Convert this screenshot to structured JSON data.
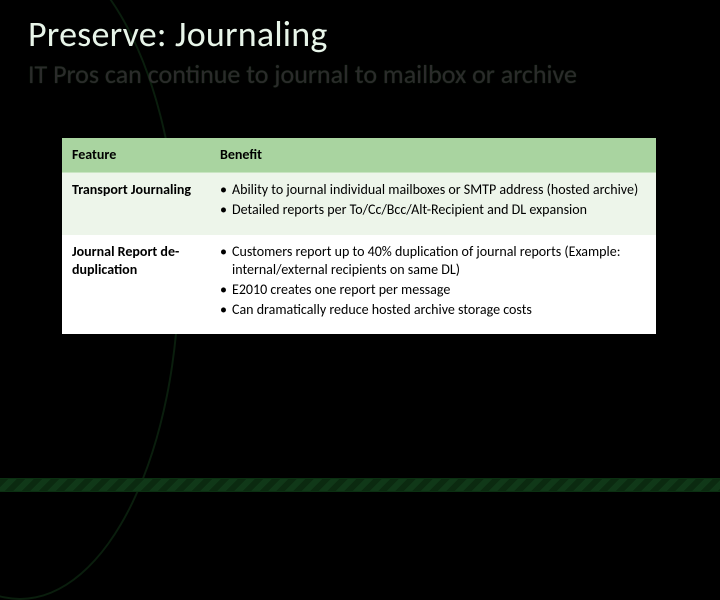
{
  "header": {
    "title": "Preserve: Journaling",
    "subtitle": "IT Pros can continue to journal to mailbox or archive"
  },
  "table": {
    "columns": [
      "Feature",
      "Benefit"
    ],
    "rows": [
      {
        "feature": "Transport Journaling",
        "benefits": [
          "Ability to journal individual mailboxes or SMTP address (hosted archive)",
          "Detailed reports per To/Cc/Bcc/Alt-Recipient and DL expansion"
        ]
      },
      {
        "feature": "Journal Report de-duplication",
        "benefits": [
          "Customers report up to 40% duplication of journal reports (Example: internal/external recipients on same DL)",
          "E2010 creates one report per message",
          "Can dramatically reduce hosted archive storage costs"
        ]
      }
    ]
  }
}
